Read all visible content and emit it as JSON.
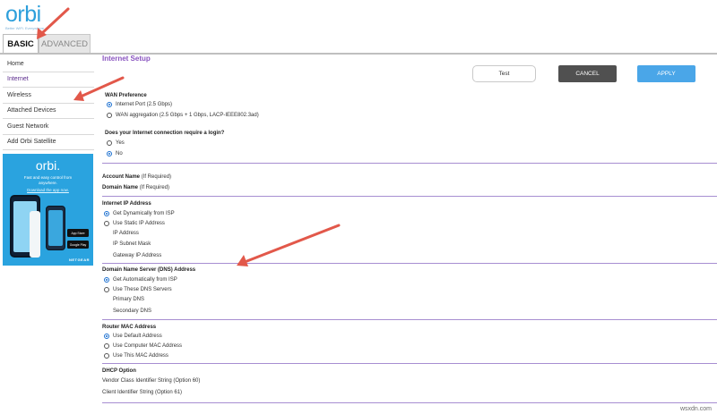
{
  "header": {
    "logo": "orbi",
    "tagline": "Better WiFi. Everywhere.",
    "tabs": [
      {
        "label": "BASIC"
      },
      {
        "label": "ADVANCED"
      }
    ]
  },
  "sidebar": {
    "items": [
      {
        "label": "Home"
      },
      {
        "label": "Internet"
      },
      {
        "label": "Wireless"
      },
      {
        "label": "Attached Devices"
      },
      {
        "label": "Guest Network"
      },
      {
        "label": "Add Orbi Satellite"
      }
    ],
    "promo": {
      "logo": "orbi.",
      "text": "Fast and easy control from anywhere.",
      "link": "Download the app now.",
      "app_store": "App Store",
      "google_play": "Google Play",
      "brand": "NETGEAR"
    }
  },
  "main": {
    "title": "Internet Setup",
    "buttons": {
      "test": "Test",
      "cancel": "CANCEL",
      "apply": "APPLY"
    },
    "wan": {
      "heading": "WAN Preference",
      "options": [
        "Internet Port (2.5 Gbps)",
        "WAN aggregation (2.5 Gbps + 1 Gbps, LACP-IEEE802.3ad)"
      ]
    },
    "login": {
      "question": "Does your Internet connection require a login?",
      "options": [
        "Yes",
        "No"
      ]
    },
    "account": {
      "account_name": "Account Name",
      "domain_name": "Domain Name",
      "hint": "(If Required)"
    },
    "ip": {
      "heading": "Internet IP Address",
      "options": [
        "Get Dynamically from ISP",
        "Use Static IP Address"
      ],
      "fields": [
        "IP Address",
        "IP Subnet Mask",
        "Gateway IP Address"
      ]
    },
    "dns": {
      "heading": "Domain Name Server (DNS) Address",
      "options": [
        "Get Automatically from ISP",
        "Use These DNS Servers"
      ],
      "fields": [
        "Primary DNS",
        "Secondary DNS"
      ]
    },
    "mac": {
      "heading": "Router MAC Address",
      "options": [
        "Use Default Address",
        "Use Computer MAC Address",
        "Use This MAC Address"
      ]
    },
    "dhcp": {
      "heading": "DHCP Option",
      "fields": [
        "Vendor Class Identifier String (Option 60)",
        "Client Identifier String (Option 61)"
      ]
    }
  },
  "watermark": "wsxdn.com",
  "colors": {
    "accent": "#8a55c0",
    "apply": "#4aa6e8",
    "cancel": "#505050",
    "arrow": "#e2584a"
  }
}
